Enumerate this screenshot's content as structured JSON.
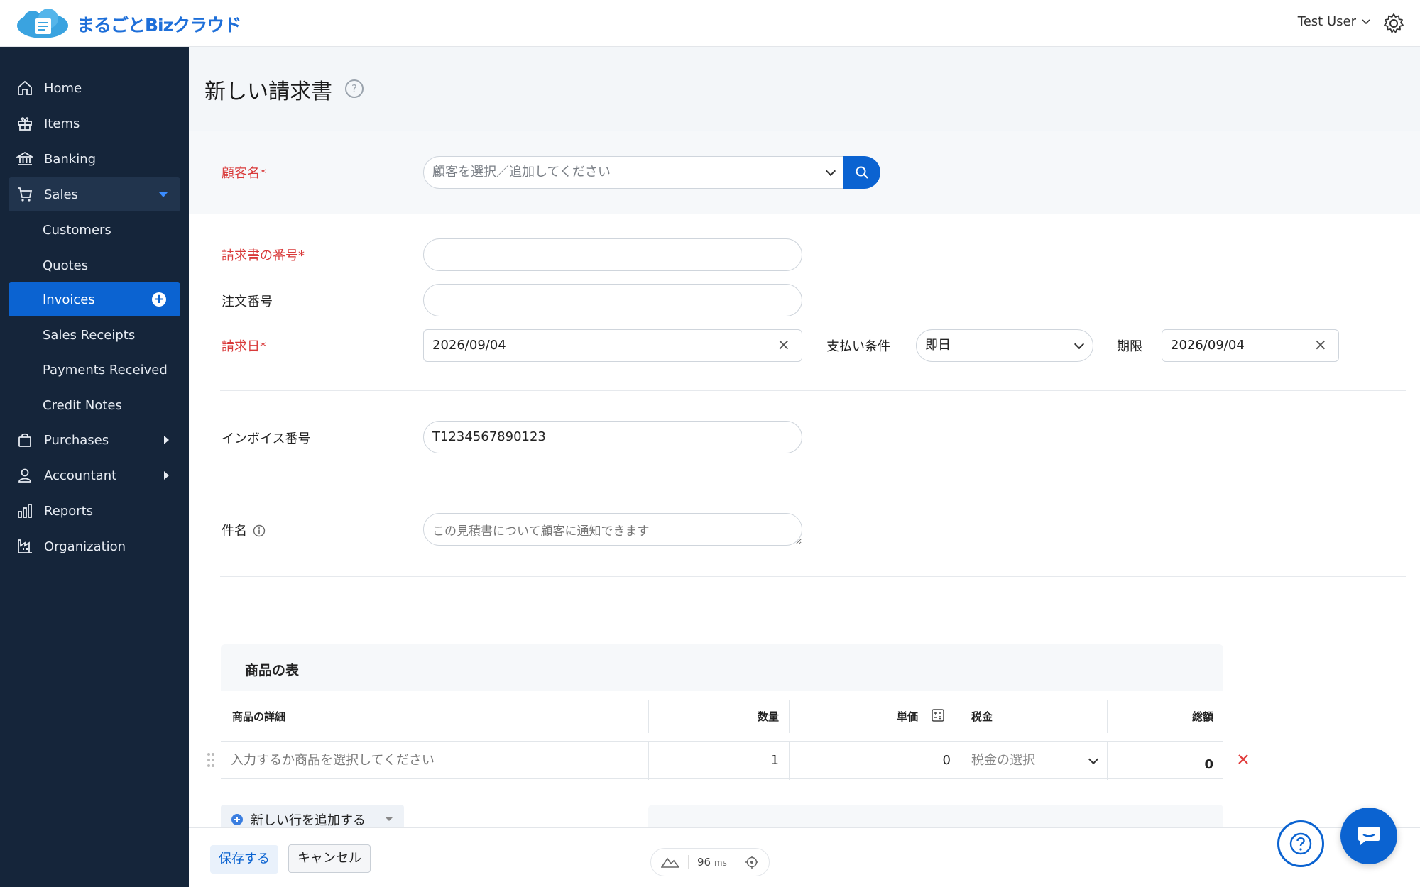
{
  "app": {
    "logo_text": "まるごとBizクラウド"
  },
  "topbar": {
    "user_name": "Test User"
  },
  "sidebar": {
    "items": [
      {
        "label": "Home",
        "icon": "home-icon"
      },
      {
        "label": "Items",
        "icon": "gift-icon"
      },
      {
        "label": "Banking",
        "icon": "bank-icon"
      },
      {
        "label": "Sales",
        "icon": "cart-icon"
      },
      {
        "label": "Customers"
      },
      {
        "label": "Quotes"
      },
      {
        "label": "Invoices"
      },
      {
        "label": "Sales Receipts"
      },
      {
        "label": "Payments Received"
      },
      {
        "label": "Credit Notes"
      },
      {
        "label": "Purchases",
        "icon": "bag-icon"
      },
      {
        "label": "Accountant",
        "icon": "person-icon"
      },
      {
        "label": "Reports",
        "icon": "bar-chart-icon"
      },
      {
        "label": "Organization",
        "icon": "building-icon"
      }
    ]
  },
  "page": {
    "title": "新しい請求書",
    "help_glyph": "?"
  },
  "form": {
    "customer_label": "顧客名*",
    "customer_placeholder": "顧客を選択／追加してください",
    "invoice_no_label": "請求書の番号*",
    "invoice_no_value": "",
    "order_no_label": "注文番号",
    "order_no_value": "",
    "invoice_date_label": "請求日*",
    "invoice_date_value": "2026/09/04",
    "payment_terms_label": "支払い条件",
    "payment_terms_value": "即日",
    "due_label": "期限",
    "due_value": "2026/09/04",
    "registration_label": "インボイス番号",
    "registration_value": "T1234567890123",
    "subject_label": "件名",
    "subject_placeholder": "この見積書について顧客に通知できます"
  },
  "items_table": {
    "title": "商品の表",
    "headers": [
      "商品の詳細",
      "数量",
      "単価",
      "税金",
      "総額"
    ],
    "row": {
      "item_placeholder": "入力するか商品を選択してください",
      "quantity": "1",
      "rate": "0",
      "tax_placeholder": "税金の選択",
      "amount": "0"
    },
    "add_row_label": "新しい行を追加する"
  },
  "bottom": {
    "save_label": "保存する",
    "cancel_label": "キャンセル",
    "perf_value": "96",
    "perf_unit": "ms"
  },
  "colors": {
    "accent": "#0b63d1",
    "sidebar_bg": "#15253a",
    "required": "#d93a3a"
  }
}
